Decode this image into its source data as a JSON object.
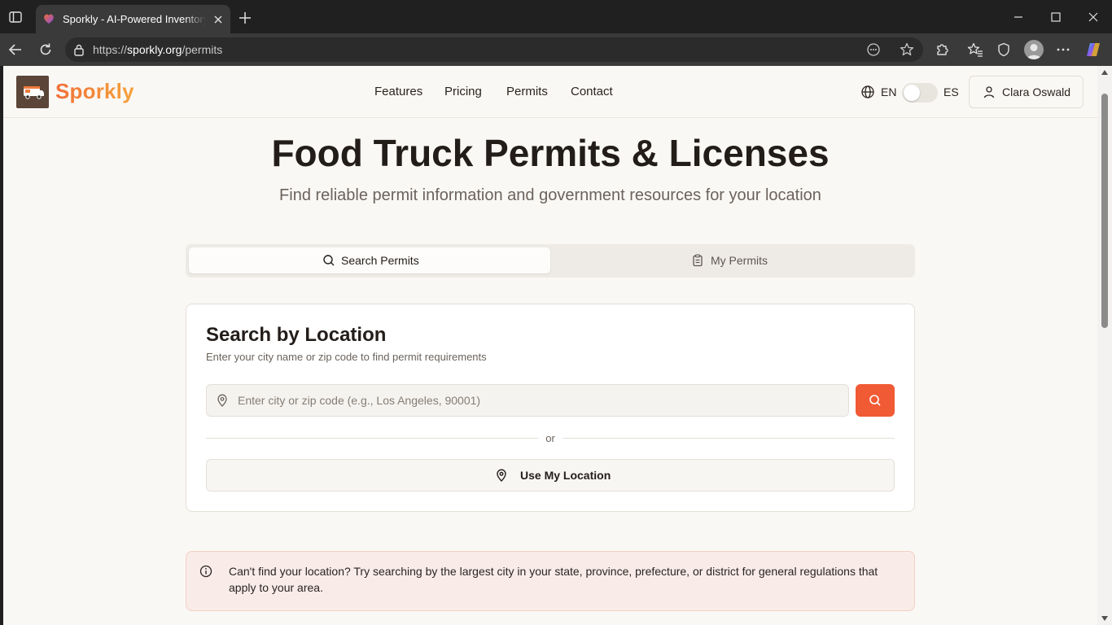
{
  "browser": {
    "tab_title": "Sporkly - AI-Powered Inventory Management",
    "url_scheme": "https://",
    "url_host": "sporkly.org",
    "url_path": "/permits"
  },
  "site": {
    "brand": "Sporkly",
    "nav": [
      "Features",
      "Pricing",
      "Permits",
      "Contact"
    ],
    "lang_en": "EN",
    "lang_es": "ES",
    "user_name": "Clara Oswald"
  },
  "hero": {
    "title": "Food Truck Permits & Licenses",
    "subtitle": "Find reliable permit information and government resources for your location"
  },
  "tabs": {
    "search": "Search Permits",
    "mine": "My Permits"
  },
  "search_card": {
    "title": "Search by Location",
    "description": "Enter your city name or zip code to find permit requirements",
    "input_placeholder": "Enter city or zip code (e.g., Los Angeles, 90001)",
    "input_value": "",
    "or": "or",
    "use_location": "Use My Location"
  },
  "alert": {
    "text": "Can't find your location? Try searching by the largest city in your state, province, prefecture, or district for general regulations that apply to your area."
  },
  "colors": {
    "accent": "#f05a35",
    "brand_orange": "#f07a3a",
    "page_bg": "#faf8f5",
    "alert_bg": "#f9ece8"
  },
  "icons": {
    "tab_search": "search-icon",
    "tab_mine": "clipboard-icon",
    "input": "map-pin-icon",
    "search_button": "search-icon",
    "location_button": "map-pin-icon",
    "alert": "info-icon",
    "language": "globe-icon",
    "user": "user-icon"
  }
}
